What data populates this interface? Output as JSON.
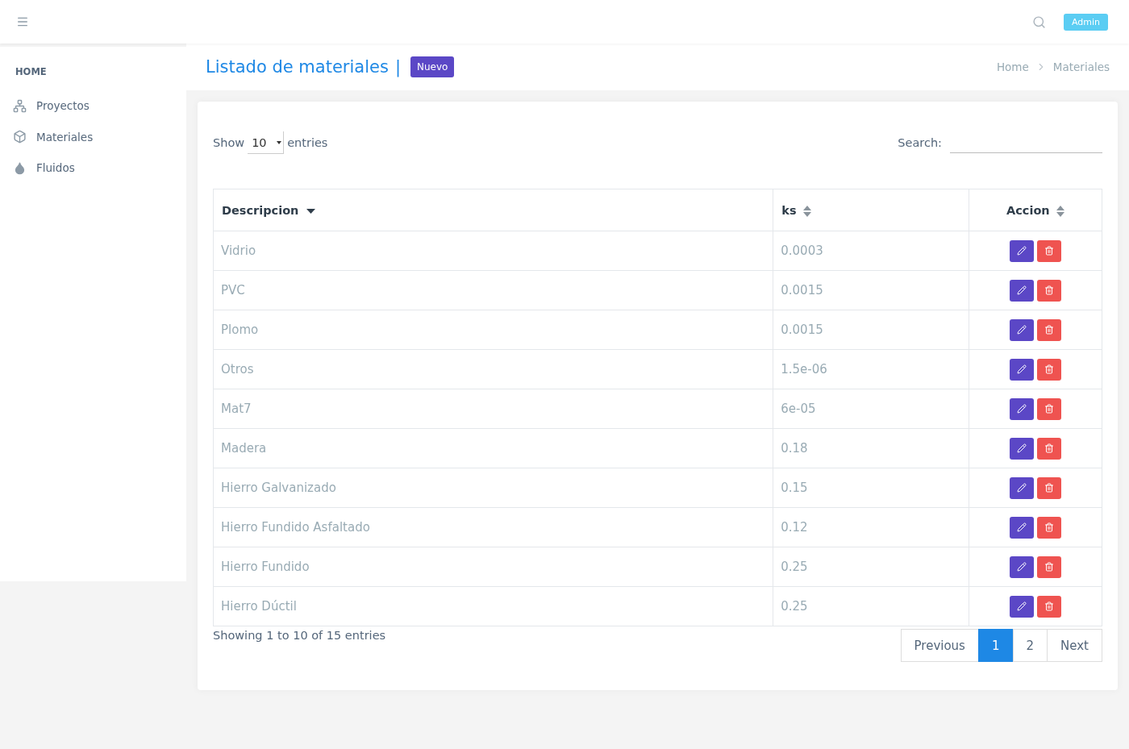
{
  "topbar": {
    "user_badge": "Admin"
  },
  "sidebar": {
    "heading": "HOME",
    "items": [
      {
        "label": "Proyectos",
        "kind": "tree"
      },
      {
        "label": "Materiales",
        "kind": "cube"
      },
      {
        "label": "Fluidos",
        "kind": "drop"
      }
    ]
  },
  "page_header": {
    "title": "Listado de materiales",
    "separator": "|",
    "new_button": "Nuevo",
    "breadcrumb": [
      "Home",
      "Materiales"
    ]
  },
  "table_controls": {
    "show_label": "Show",
    "page_size": "10",
    "entries_label": "entries",
    "search_label": "Search:"
  },
  "table": {
    "columns": [
      {
        "label": "Descripcion",
        "sorted": true
      },
      {
        "label": "ks",
        "sorted": false
      },
      {
        "label": "Accion",
        "sorted": false
      }
    ],
    "rows": [
      {
        "descripcion": "Vidrio",
        "ks": "0.0003"
      },
      {
        "descripcion": "PVC",
        "ks": "0.0015"
      },
      {
        "descripcion": "Plomo",
        "ks": "0.0015"
      },
      {
        "descripcion": "Otros",
        "ks": "1.5e-06"
      },
      {
        "descripcion": "Mat7",
        "ks": "6e-05"
      },
      {
        "descripcion": "Madera",
        "ks": "0.18"
      },
      {
        "descripcion": "Hierro Galvanizado",
        "ks": "0.15"
      },
      {
        "descripcion": "Hierro Fundido Asfaltado",
        "ks": "0.12"
      },
      {
        "descripcion": "Hierro Fundido",
        "ks": "0.25"
      },
      {
        "descripcion": "Hierro Dúctil",
        "ks": "0.25"
      }
    ]
  },
  "footer": {
    "info": "Showing 1 to 10 of 15 entries",
    "previous": "Previous",
    "pages": [
      {
        "label": "1",
        "selected": true
      },
      {
        "label": "2",
        "selected": false
      }
    ],
    "next": "Next"
  }
}
